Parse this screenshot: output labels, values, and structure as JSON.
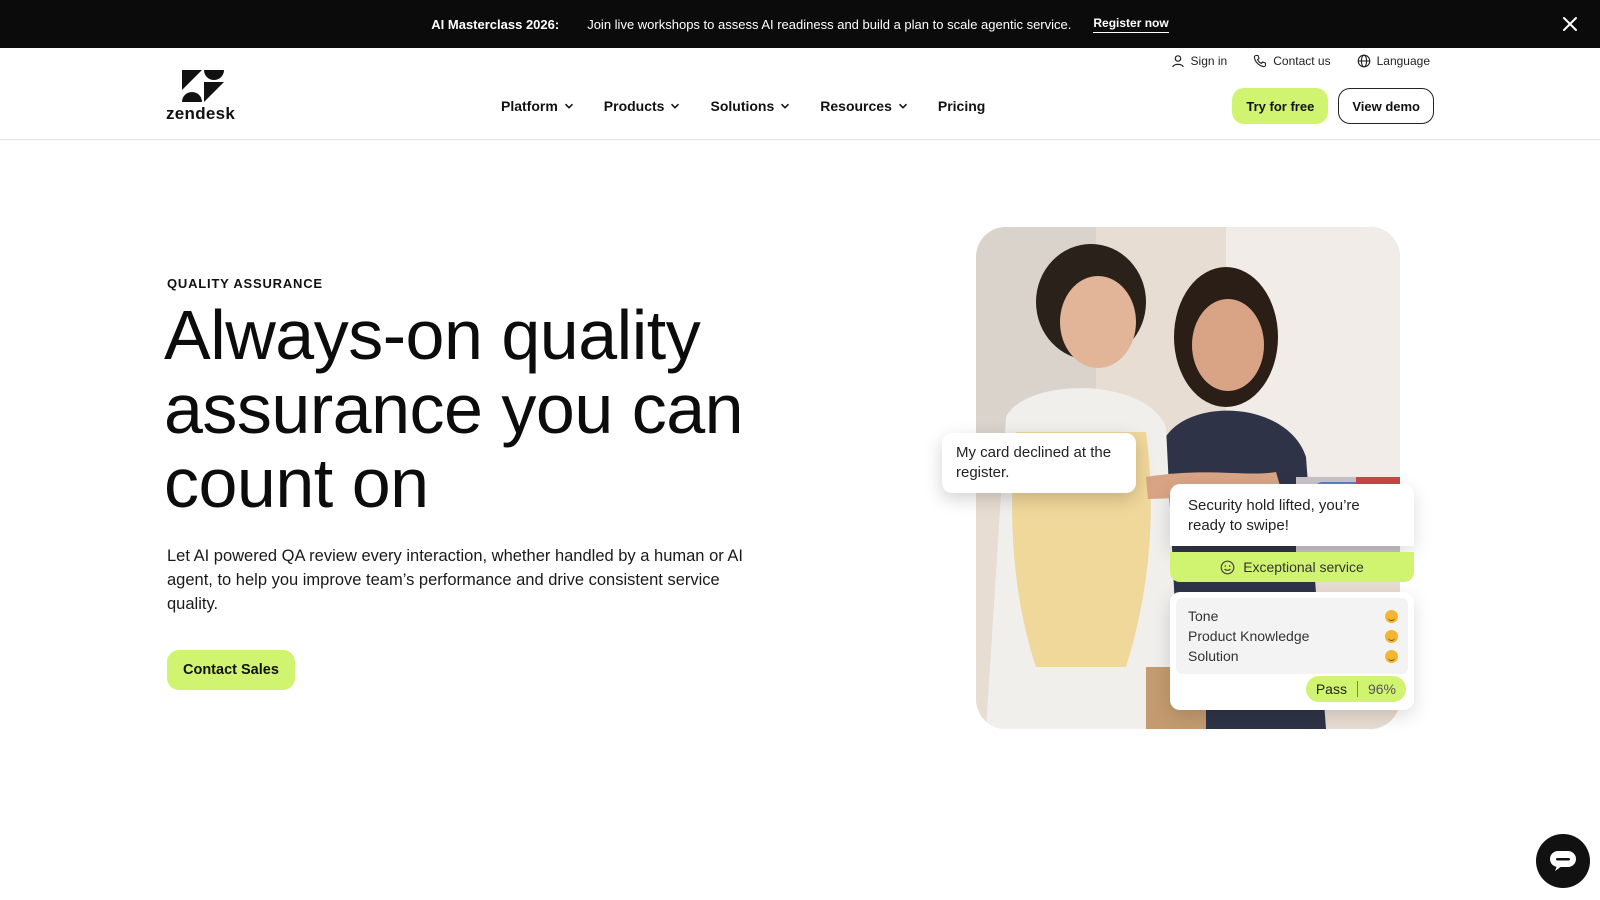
{
  "promo": {
    "title": "AI Masterclass 2026:",
    "text": "Join live workshops to assess AI readiness and build a plan to scale agentic service.",
    "link": "Register now"
  },
  "header": {
    "logo_text": "zendesk",
    "utility": {
      "sign_in": "Sign in",
      "contact": "Contact us",
      "language": "Language"
    },
    "nav": {
      "platform": "Platform",
      "products": "Products",
      "solutions": "Solutions",
      "resources": "Resources",
      "pricing": "Pricing"
    },
    "try_free": "Try for free",
    "view_demo": "View demo"
  },
  "hero": {
    "eyebrow": "QUALITY ASSURANCE",
    "headline": "Always-on quality assurance you can count on",
    "lede": "Let AI powered QA review every interaction, whether handled by a human or AI agent, to help you improve team’s performance and drive consistent service quality.",
    "cta": "Contact Sales"
  },
  "visual": {
    "customer_message": "My card declined at the register.",
    "agent_message": "Security hold lifted, you’re ready to swipe!",
    "exceptional_tag": "Exceptional service",
    "scores": {
      "tone": "Tone",
      "product_knowledge": "Product Knowledge",
      "solution": "Solution"
    },
    "result": "Pass",
    "percent": "96%"
  },
  "colors": {
    "accent": "#d1f470",
    "promo_bg": "#0b0b0b",
    "text": "#0c0c0c"
  }
}
